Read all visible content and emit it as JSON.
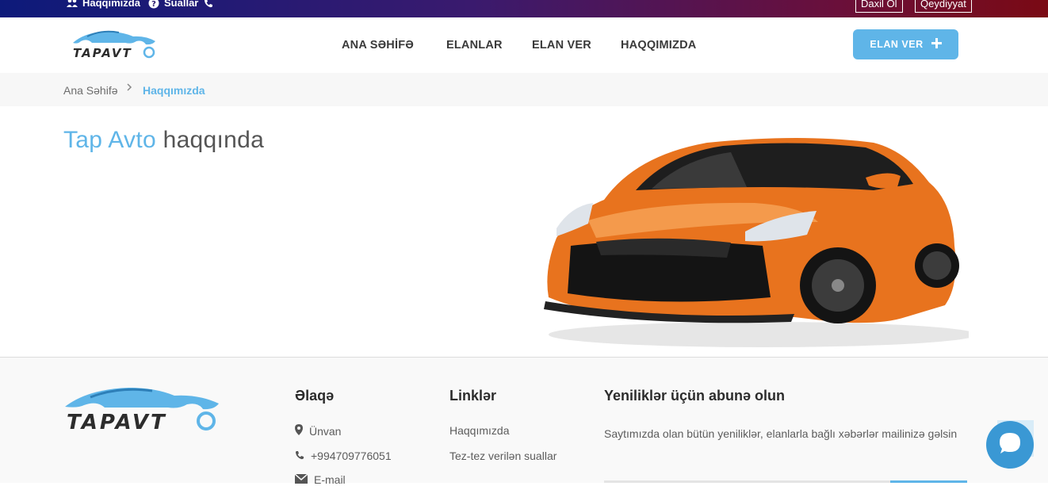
{
  "topbar": {
    "about_label": "Haqqımızda",
    "faq_label": "Suallar",
    "login_label": "Daxil Ol",
    "register_label": "Qeydiyyat"
  },
  "brand": {
    "logo_text": "TAPAVTO",
    "accent": "#5fb5e8"
  },
  "nav": {
    "items": [
      "ANA SƏHİFƏ",
      "ELANLAR",
      "ELAN VER",
      "HAQQIMIZDA"
    ],
    "cta_label": "ELAN VER",
    "cta_icon": "plus-icon"
  },
  "breadcrumb": {
    "home": "Ana Səhifə",
    "current": "Haqqımızda"
  },
  "hero": {
    "title_highlight": "Tap Avto",
    "title_rest": "haqqında"
  },
  "footer": {
    "contact": {
      "heading": "Əlaqə",
      "address_label": "Ünvan",
      "phone": "+994709776051",
      "email_label": "E-mail"
    },
    "links": {
      "heading": "Linklər",
      "items": [
        "Haqqımızda",
        "Tez-tez verilən suallar"
      ]
    },
    "subscribe": {
      "heading": "Yeniliklər üçün abunə olun",
      "text": "Saytımızda olan bütün yeniliklər, elanlarla bağlı xəbərlər mailinizə gəlsin"
    }
  },
  "colors": {
    "accent": "#5fb5e8",
    "chat": "#3a98d4",
    "car": "#e8731e"
  }
}
